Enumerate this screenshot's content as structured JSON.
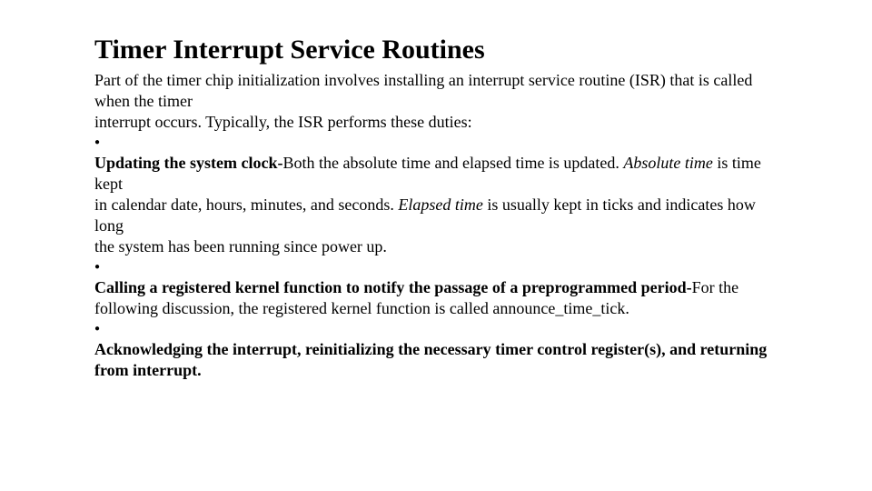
{
  "title": "Timer Interrupt Service Routines",
  "intro_l1": "Part of the timer chip initialization involves installing an interrupt service routine (ISR) that is called when the timer",
  "intro_l2": "interrupt occurs. Typically, the ISR performs these duties:",
  "bullet": "●",
  "item1_bold": "Updating the system clock-",
  "item1_text1": "Both the absolute time and elapsed time is updated. ",
  "item1_italic1": "Absolute time",
  "item1_text2": " is time kept",
  "item1_l2a": "in calendar date, hours, minutes, and seconds. ",
  "item1_italic2": "Elapsed time",
  "item1_l2b": " is usually kept in ticks and indicates how long",
  "item1_l3": "the system has been running since power up.",
  "item2_bold": "Calling a registered kernel function to notify the passage of a preprogrammed period-",
  "item2_text": "For the following discussion, the registered kernel function is called announce_time_tick.",
  "item3_bold_l1": "Acknowledging the interrupt, reinitializing the necessary timer control register(s), and returning",
  "item3_bold_l2": "from interrupt."
}
